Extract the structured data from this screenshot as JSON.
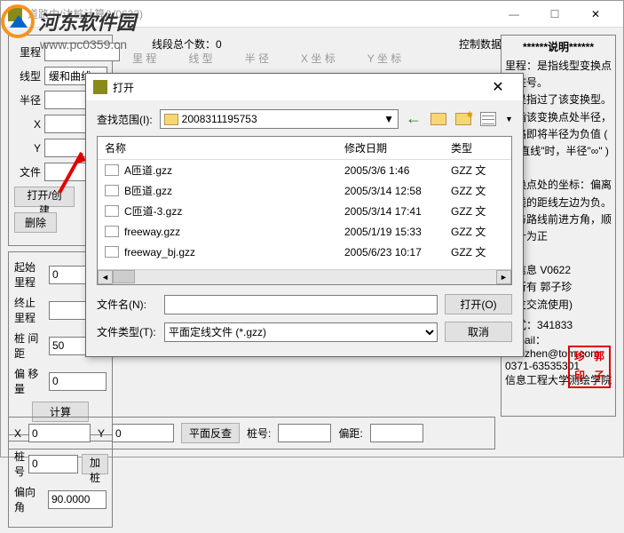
{
  "window": {
    "title": "道路中/边桩计算(V0622)",
    "minimize": "—",
    "maximize": "☐",
    "close": "✕"
  },
  "watermark": {
    "site_name": "河东软件园",
    "url": "www.pc0359.cn"
  },
  "control_data_label": "控制数据",
  "segment_count_label": "线段总个数：",
  "segment_count_value": "0",
  "table_headers": {
    "licheng": "里  程",
    "xianxing": "线  型",
    "banjing": "半  径",
    "xzuobiao": "X 坐 标",
    "yzuobiao": "Y 坐 标"
  },
  "left": {
    "licheng_lbl": "里程",
    "xianxing_lbl": "线型",
    "xianxing_sel": "缓和曲线",
    "banjing_lbl": "半径",
    "x_lbl": "X",
    "y_lbl": "Y",
    "file_lbl": "文件",
    "open_create_btn": "打开/创建",
    "delete_btn": "删除",
    "start_li_lbl": "起始里程",
    "start_li_val": "0",
    "end_li_lbl": "终止里程",
    "end_li_val": "",
    "pile_dist_lbl": "桩 间 距",
    "pile_dist_val": "50",
    "offset_lbl": "偏 移 量",
    "offset_val": "0",
    "calc_btn": "计算",
    "pile_no_lbl": "桩号",
    "pile_no_val": "0",
    "add_btn": "加桩",
    "deflect_lbl": "偏向角",
    "deflect_val": "90.0000"
  },
  "bottom": {
    "x_lbl": "X",
    "x_val": "0",
    "y_lbl": "Y",
    "y_val": "0",
    "reverse_btn": "平面反查",
    "pile_lbl": "桩号:",
    "pile_val": "",
    "offset_lbl": "偏距:",
    "offset_val": ""
  },
  "instructions": {
    "header": "******说明******",
    "body": "里程：是指线型变换点的桩号。\n：是指过了该变换型。\n是指该变换点处半径，线路即将半径为负值 ( 当\"直线\"时，半径\"∞\" ) 。\n变换点处的坐标：偏离中线的距线左边为负。\n：与路线前进方角，顺时针为正\n\n本信息  V0622\n权所有  郭子珍\n网友交流使用)",
    "tel_lbl": "方式：",
    "tel_val": "341833",
    "email_lbl": "E-mail：",
    "email_val": "hnzizhen@tom.com",
    "phone": "0371-63535301",
    "school": "信息工程大学测绘学院"
  },
  "seal": {
    "c1": "珍",
    "c2": "郭",
    "c3": "印",
    "c4": "子"
  },
  "dialog": {
    "title": "打开",
    "close": "✕",
    "lookin_lbl": "查找范围(I):",
    "folder": "2008311195753",
    "columns": {
      "name": "名称",
      "date": "修改日期",
      "type": "类型"
    },
    "files": [
      {
        "name": "A匝道.gzz",
        "date": "2005/3/6 1:46",
        "type": "GZZ 文"
      },
      {
        "name": "B匝道.gzz",
        "date": "2005/3/14 12:58",
        "type": "GZZ 文"
      },
      {
        "name": "C匝道-3.gzz",
        "date": "2005/3/14 17:41",
        "type": "GZZ 文"
      },
      {
        "name": "freeway.gzz",
        "date": "2005/1/19 15:33",
        "type": "GZZ 文"
      },
      {
        "name": "freeway_bj.gzz",
        "date": "2005/6/23 10:17",
        "type": "GZZ 文"
      }
    ],
    "filename_lbl": "文件名(N):",
    "filename_val": "",
    "filetype_lbl": "文件类型(T):",
    "filetype_val": "平面定线文件 (*.gzz)",
    "open_btn": "打开(O)",
    "cancel_btn": "取消"
  }
}
